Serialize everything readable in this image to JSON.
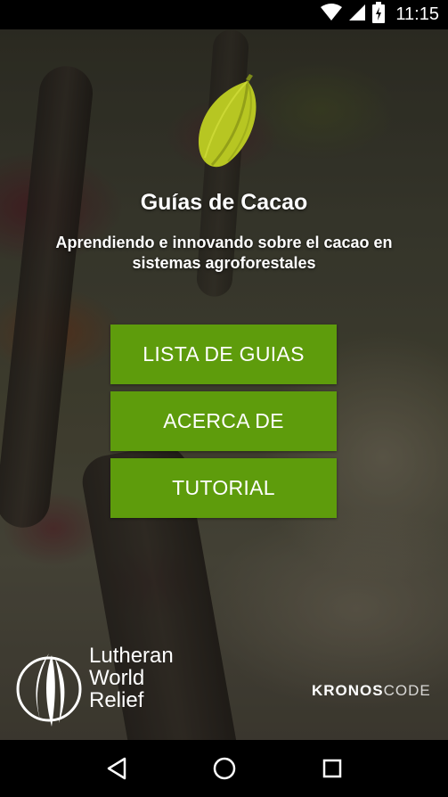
{
  "status_bar": {
    "time": "11:15",
    "icons": [
      "wifi-icon",
      "signal-icon",
      "battery-icon"
    ]
  },
  "app": {
    "title": "Guías de Cacao",
    "subtitle": "Aprendiendo e innovando sobre el cacao en sistemas agroforestales",
    "logo_icon": "cacao-pod-icon"
  },
  "menu": {
    "buttons": [
      {
        "label": "LISTA DE GUIAS"
      },
      {
        "label": "ACERCA DE"
      },
      {
        "label": "TUTORIAL"
      }
    ],
    "button_color": "#5e9c0c"
  },
  "footer": {
    "lwr": {
      "line1": "Lutheran",
      "line2": "World",
      "line3": "Relief"
    },
    "kronos": {
      "part1": "KRONOS",
      "part2": "CODE"
    }
  },
  "nav_bar": {
    "icons": [
      "back-icon",
      "home-icon",
      "recents-icon"
    ]
  }
}
